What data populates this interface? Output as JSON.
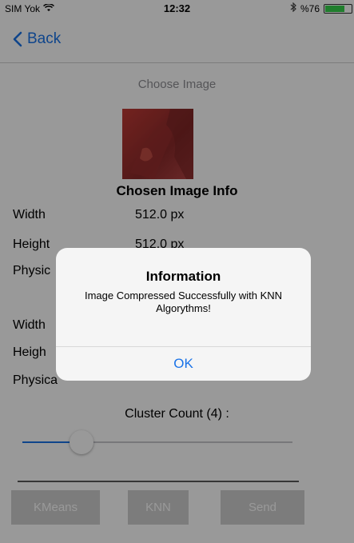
{
  "status_bar": {
    "carrier": "SIM Yok",
    "time": "12:32",
    "battery_text": "%76",
    "battery_level": 0.76,
    "icons": [
      "wifi-icon",
      "bluetooth-icon",
      "battery-icon"
    ]
  },
  "nav": {
    "back_label": "Back"
  },
  "choose_image": {
    "label": "Choose Image"
  },
  "image_info": {
    "title": "Chosen Image Info",
    "rows": [
      {
        "key": "Width",
        "value": "512.0 px"
      },
      {
        "key": "Height",
        "value": "512.0 px"
      },
      {
        "key": "Physic",
        "value": ""
      },
      {
        "key": "Width",
        "value": ""
      },
      {
        "key": "Heigh",
        "value": ""
      },
      {
        "key": "Physica",
        "value": ""
      }
    ]
  },
  "cluster": {
    "label": "Cluster Count (4) :",
    "value": 4,
    "slider_fraction": 0.22
  },
  "buttons": {
    "kmeans": "KMeans",
    "knn": "KNN",
    "send": "Send"
  },
  "alert": {
    "title": "Information",
    "message": "Image Compressed Successfully with KNN Algorythms!",
    "ok": "OK"
  },
  "colors": {
    "accent": "#1a73e8",
    "battery": "#36d34b",
    "disabled_button": "#cfcfcf",
    "image_tint": "#c03a35"
  }
}
